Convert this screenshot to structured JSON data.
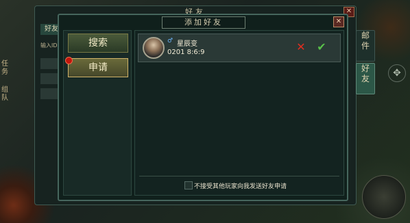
{
  "back_window": {
    "title": "好友",
    "close_label": "✕",
    "tab_label": "好友",
    "input_label": "输入ID"
  },
  "left_strip": {
    "items": [
      "任",
      "务",
      "组",
      "队"
    ]
  },
  "side_tabs": [
    {
      "label_top": "邮",
      "label_bottom": "件"
    },
    {
      "label_top": "好",
      "label_bottom": "友"
    }
  ],
  "dialog": {
    "title": "添加好友",
    "close_label": "✕",
    "buttons": {
      "search": "搜索",
      "apply": "申请"
    },
    "requests": [
      {
        "name": "星辰变",
        "time": "0201 8:6:9",
        "decline": "✕",
        "accept": "✔"
      }
    ],
    "option_label": "不接受其他玩家向我发送好友申请"
  },
  "icons": {
    "move": "✥",
    "gender": "♂"
  }
}
